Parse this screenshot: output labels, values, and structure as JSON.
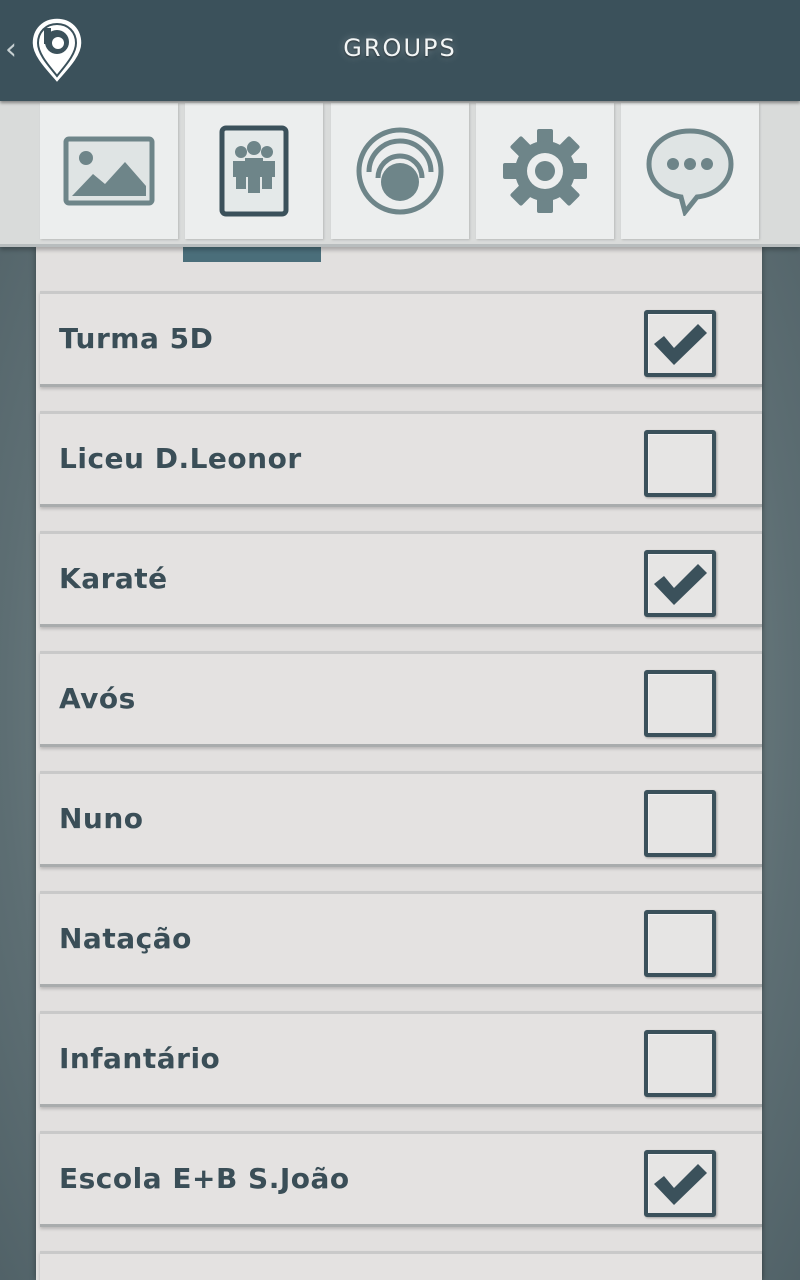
{
  "header": {
    "title": "GROUPS",
    "back_icon": "chevron-left-icon",
    "logo_icon": "location-pin-logo"
  },
  "toolbar": {
    "tabs": [
      {
        "name": "gallery",
        "icon": "image-icon",
        "active": false
      },
      {
        "name": "groups",
        "icon": "groups-icon",
        "active": true
      },
      {
        "name": "signal",
        "icon": "signal-icon",
        "active": false
      },
      {
        "name": "settings",
        "icon": "gear-icon",
        "active": false
      },
      {
        "name": "messages",
        "icon": "chat-bubble-icon",
        "active": false
      }
    ]
  },
  "groups": [
    {
      "label": "Turma 5D",
      "checked": true
    },
    {
      "label": "Liceu D.Leonor",
      "checked": false
    },
    {
      "label": "Karaté",
      "checked": true
    },
    {
      "label": "Avós",
      "checked": false
    },
    {
      "label": "Nuno",
      "checked": false
    },
    {
      "label": "Natação",
      "checked": false
    },
    {
      "label": "Infantário",
      "checked": false
    },
    {
      "label": "Escola E+B S.João",
      "checked": true
    }
  ],
  "colors": {
    "header_bg": "#3b515b",
    "accent": "#4a6e7a",
    "text": "#3a4e57",
    "icon": "#6e8589"
  }
}
